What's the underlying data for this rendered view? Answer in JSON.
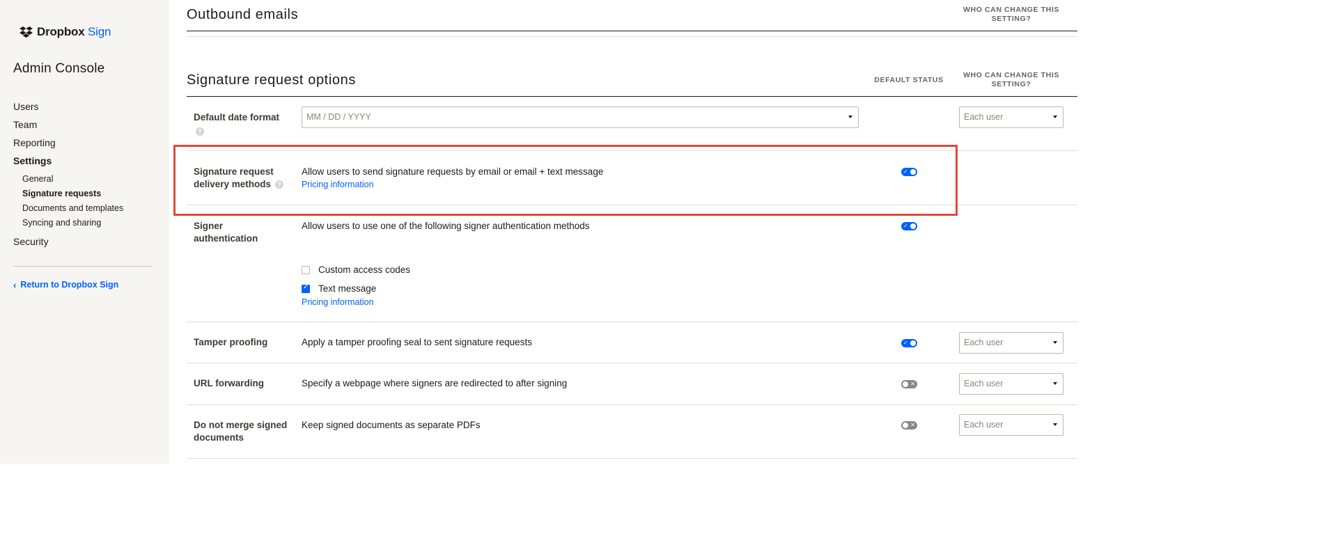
{
  "brand": {
    "name": "Dropbox",
    "accent": "Sign",
    "color": "#0061fe"
  },
  "sidebar": {
    "title": "Admin Console",
    "items": [
      {
        "label": "Users"
      },
      {
        "label": "Team"
      },
      {
        "label": "Reporting"
      },
      {
        "label": "Settings"
      }
    ],
    "settings_sub": [
      {
        "label": "General"
      },
      {
        "label": "Signature requests"
      },
      {
        "label": "Documents and templates"
      },
      {
        "label": "Syncing and sharing"
      }
    ],
    "security": "Security",
    "return_link": "Return to Dropbox Sign"
  },
  "outbound": {
    "title": "Outbound emails",
    "who_can_change": "WHO CAN CHANGE THIS SETTING?"
  },
  "signature_options": {
    "title": "Signature request options",
    "default_status": "DEFAULT STATUS",
    "who_can_change": "WHO CAN CHANGE THIS SETTING?"
  },
  "rows": {
    "date_format": {
      "label": "Default date format",
      "select_value": "MM / DD / YYYY",
      "who": "Each user"
    },
    "delivery": {
      "label": "Signature request delivery methods",
      "description": "Allow users to send signature requests by email or email + text message",
      "link": "Pricing information",
      "status": "on"
    },
    "signer_auth": {
      "label": "Signer authentication",
      "description": "Allow users to use one of the following signer authentication methods",
      "status": "on",
      "options": [
        {
          "label": "Custom access codes",
          "checked": false
        },
        {
          "label": "Text message",
          "checked": true
        }
      ],
      "link": "Pricing information"
    },
    "tamper": {
      "label": "Tamper proofing",
      "description": "Apply a tamper proofing seal to sent signature requests",
      "status": "on",
      "who": "Each user"
    },
    "url_forwarding": {
      "label": "URL forwarding",
      "description": "Specify a webpage where signers are redirected to after signing",
      "status": "off",
      "who": "Each user"
    },
    "no_merge": {
      "label": "Do not merge signed documents",
      "description": "Keep signed documents as separate PDFs",
      "status": "off",
      "who": "Each user"
    }
  },
  "colors": {
    "accent": "#0061fe",
    "highlight": "#e0483d",
    "sidebar_bg": "#f7f5f2"
  }
}
